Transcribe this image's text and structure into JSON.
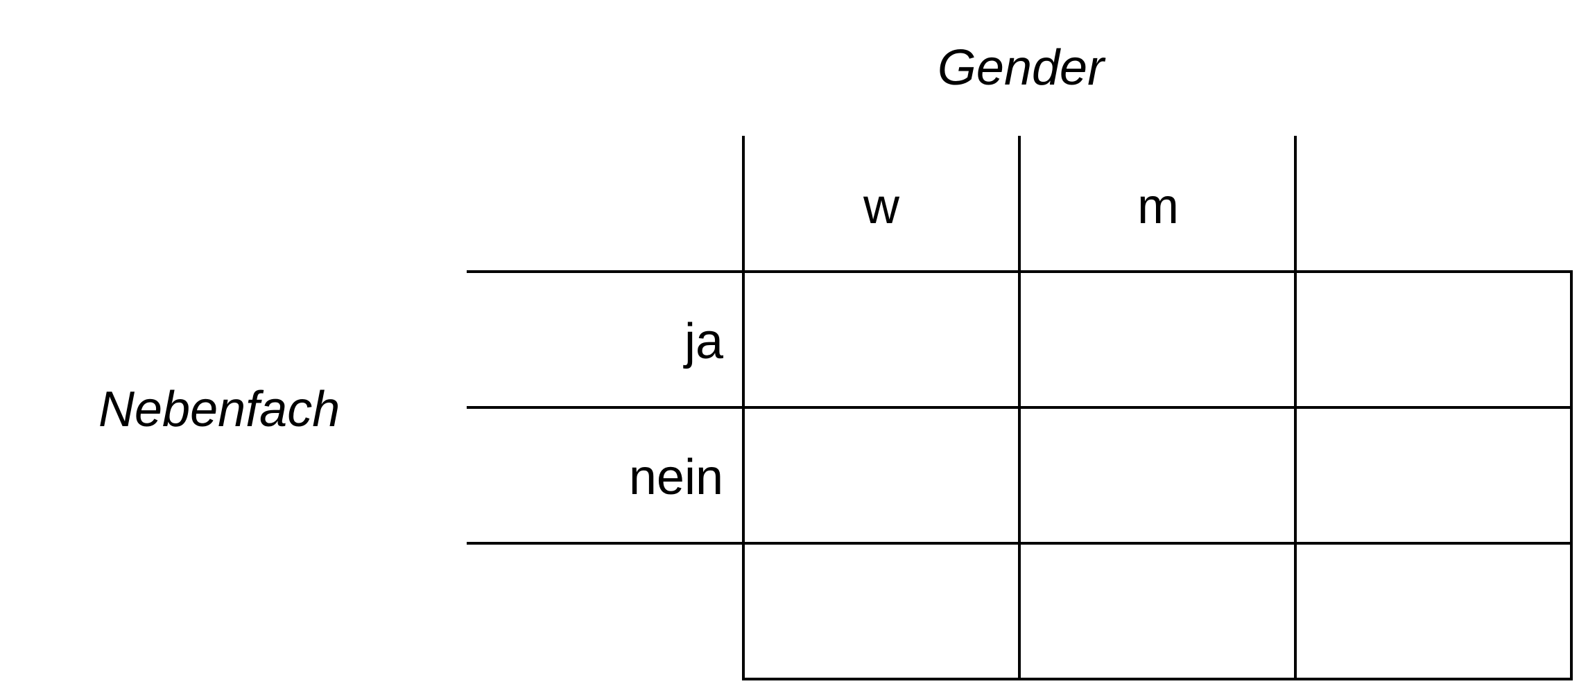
{
  "table": {
    "column_variable": "Gender",
    "row_variable": "Nebenfach",
    "column_headers": [
      "w",
      "m",
      ""
    ],
    "row_headers": [
      "ja",
      "nein",
      ""
    ],
    "cells": [
      [
        "",
        "",
        ""
      ],
      [
        "",
        "",
        ""
      ],
      [
        "",
        "",
        ""
      ]
    ]
  }
}
